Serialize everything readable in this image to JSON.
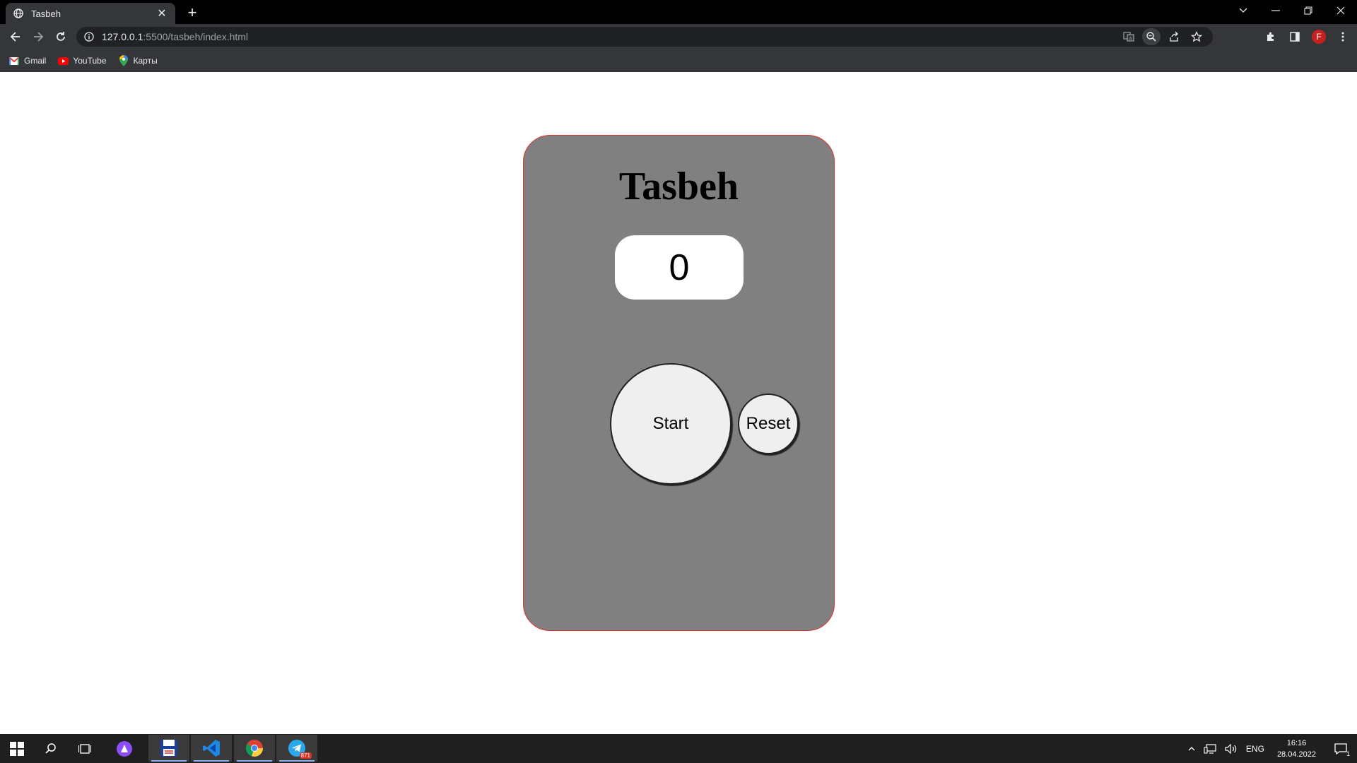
{
  "browser": {
    "tab": {
      "title": "Tasbeh",
      "favicon": "globe-icon",
      "close_icon": "close-icon",
      "close_glyph": "✕"
    },
    "new_tab_glyph": "+",
    "url": {
      "host": "127.0.0.1",
      "rest": ":5500/tasbeh/index.html"
    },
    "profile_initial": "F",
    "bookmarks": [
      {
        "label": "Gmail",
        "icon": "gmail-icon"
      },
      {
        "label": "YouTube",
        "icon": "youtube-icon"
      },
      {
        "label": "Карты",
        "icon": "maps-icon"
      }
    ]
  },
  "page": {
    "title": "Tasbeh",
    "counter": "0",
    "start_label": "Start",
    "reset_label": "Reset"
  },
  "taskbar": {
    "telegram_badge": "871",
    "language": "ENG",
    "time": "16:16",
    "date": "28.04.2022",
    "notifications": "1"
  },
  "colors": {
    "card_bg": "#808080",
    "card_border": "#e2332b",
    "button_bg": "#efefef",
    "chrome_bg": "#35363a"
  }
}
